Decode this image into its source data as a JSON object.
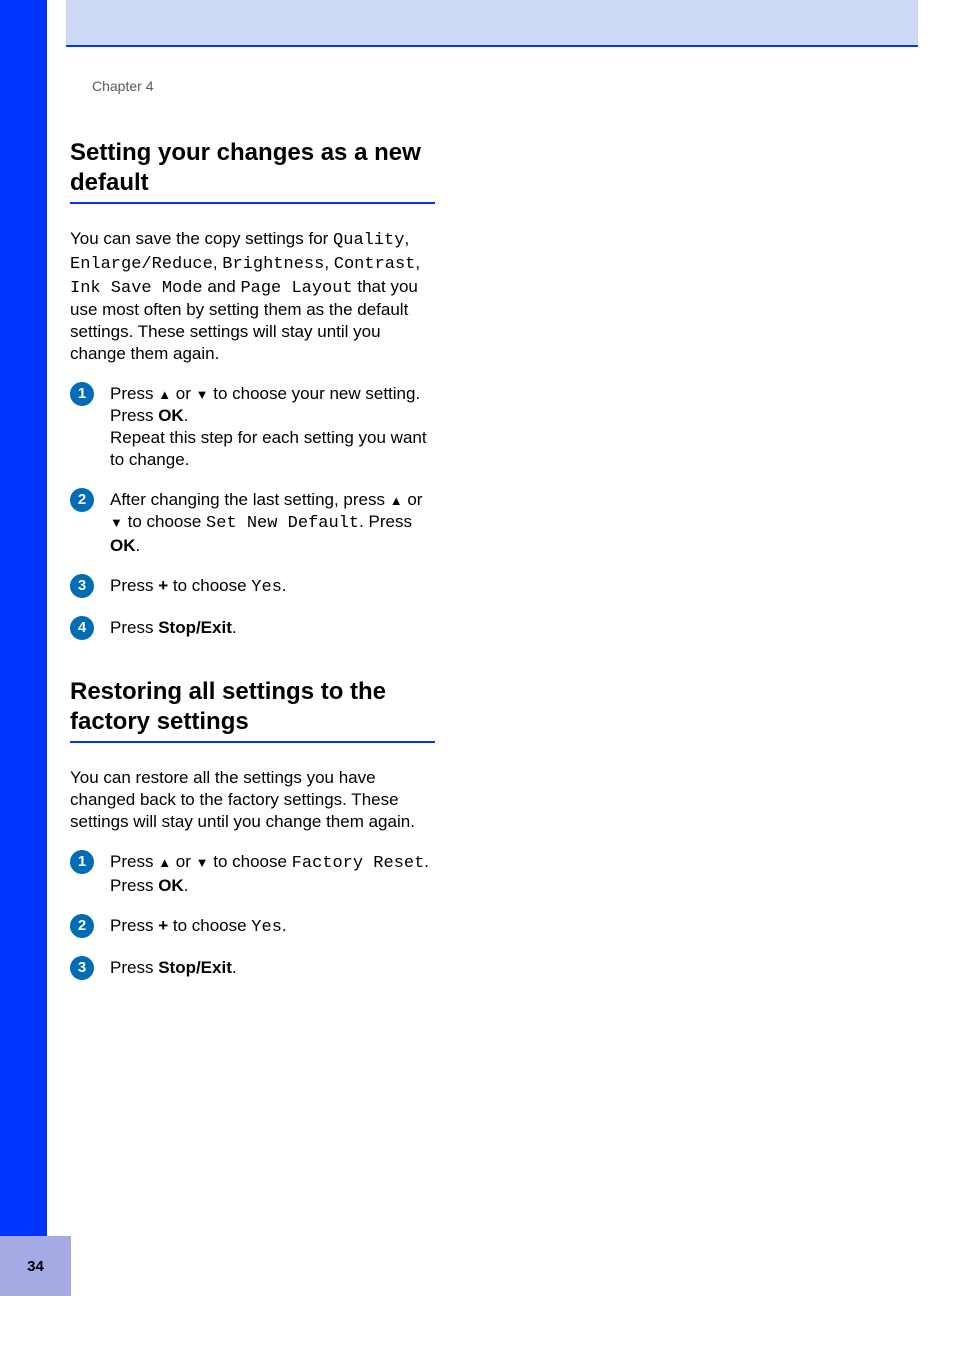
{
  "page_number": "34",
  "chapter_label": "Chapter 4",
  "section1": {
    "title": "Setting your changes as a new default",
    "intro_pre": "You can save the copy settings for ",
    "mono1": "Quality",
    "sep1": ", ",
    "mono2": "Enlarge/Reduce",
    "sep2": ", ",
    "mono3": "Brightness",
    "sep3": ", ",
    "mono4": "Contrast",
    "sep4": ", ",
    "mono5": "Ink Save Mode",
    "and": " and ",
    "mono6": "Page Layout",
    "intro_post": " that you use most often by setting them as the default settings. These settings will stay until you change them again.",
    "steps": [
      {
        "t1": "Press ",
        "arrow_up": "▲",
        "t_or1": " or ",
        "arrow_down": "▼",
        "t2": " to choose your new setting. Press ",
        "ok": "OK",
        "t3": ".",
        "t4": "Repeat this step for each setting you want to change."
      },
      {
        "t1": "After changing the last setting, press ",
        "arrow_up": "▲",
        "t_or1": " or ",
        "arrow_down": "▼",
        "t2": " to choose ",
        "mono": "Set New Default",
        "t3": ". Press ",
        "ok": "OK",
        "t4": "."
      },
      {
        "t1": "Press ",
        "plus": "+",
        "t2": " to choose ",
        "mono": "Yes",
        "t3": "."
      },
      {
        "t1": "Press ",
        "bold": "Stop/Exit",
        "t2": "."
      }
    ]
  },
  "section2": {
    "title": "Restoring all settings to the factory settings",
    "intro": "You can restore all the settings you have changed back to the factory settings. These settings will stay until you change them again.",
    "steps": [
      {
        "t1": "Press ",
        "arrow_up": "▲",
        "t_or1": " or ",
        "arrow_down": "▼",
        "t2": " to choose ",
        "mono": "Factory Reset",
        "t3": ".",
        "t4": "Press ",
        "ok": "OK",
        "t5": "."
      },
      {
        "t1": "Press ",
        "plus": "+",
        "t2": " to choose ",
        "mono": "Yes",
        "t3": "."
      },
      {
        "t1": "Press ",
        "bold": "Stop/Exit",
        "t2": "."
      }
    ]
  }
}
